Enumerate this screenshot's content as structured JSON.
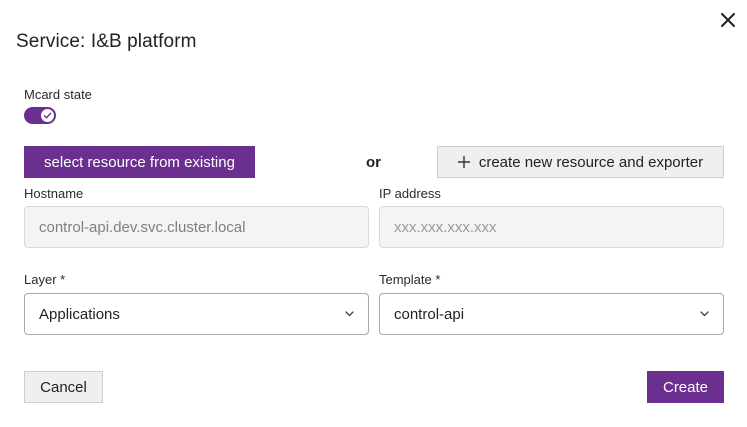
{
  "dialog": {
    "title": "Service: I&B platform"
  },
  "mcard": {
    "label": "Mcard state",
    "enabled": true
  },
  "resource": {
    "select_existing_label": "select resource from existing",
    "or_label": "or",
    "create_new_label": "create new resource and exporter"
  },
  "hostname": {
    "label": "Hostname",
    "value": "control-api.dev.svc.cluster.local"
  },
  "ip_address": {
    "label": "IP address",
    "placeholder": "xxx.xxx.xxx.xxx"
  },
  "layer": {
    "label": "Layer *",
    "value": "Applications"
  },
  "template": {
    "label": "Template *",
    "value": "control-api"
  },
  "footer": {
    "cancel_label": "Cancel",
    "create_label": "Create"
  },
  "colors": {
    "accent": "#6a2f8f",
    "secondary_button_bg": "#efefef",
    "disabled_input_bg": "#f4f4f4"
  },
  "icons": {
    "close": "close-icon",
    "toggle_check": "check-icon",
    "plus": "plus-icon",
    "chevron": "chevron-down-icon"
  }
}
